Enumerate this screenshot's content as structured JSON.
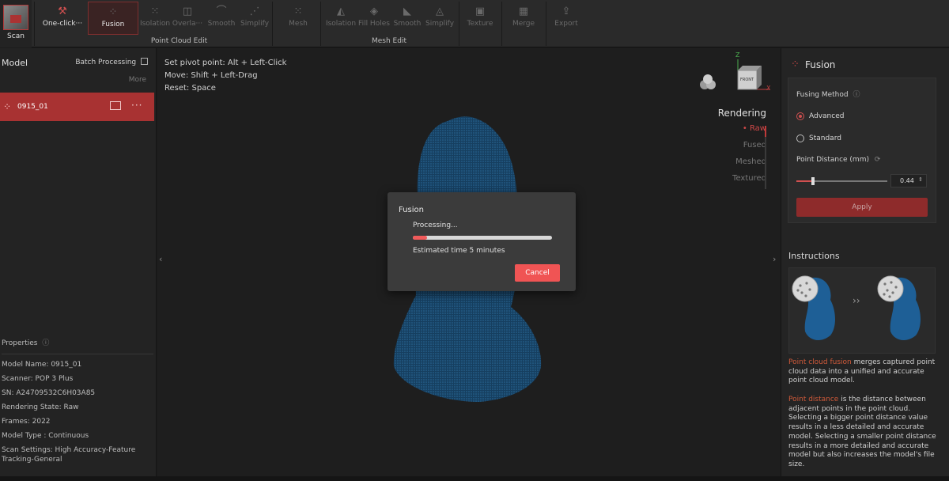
{
  "toolbar": {
    "scan_label": "Scan",
    "one_click_label": "One-click···",
    "fusion_label": "Fusion",
    "isolation_label": "Isolation",
    "overlap_label": "Overla···",
    "smooth_label": "Smooth",
    "simplify_label": "Simplify",
    "point_cloud_edit_label": "Point Cloud Edit",
    "mesh_label": "Mesh",
    "mesh_isolation_label": "Isolation",
    "fill_holes_label": "Fill Holes",
    "mesh_smooth_label": "Smooth",
    "mesh_simplify_label": "Simplify",
    "mesh_edit_label": "Mesh Edit",
    "texture_label": "Texture",
    "merge_label": "Merge",
    "export_label": "Export"
  },
  "left": {
    "title": "Model",
    "batch_label": "Batch Processing",
    "more_label": "More",
    "model_name": "0915_01",
    "menu_label": "···",
    "properties_title": "Properties",
    "properties": [
      "Model Name:  0915_01",
      "Scanner:  POP 3 Plus",
      "SN:  A24709532C6H03A85",
      "Rendering State:  Raw",
      "Frames:  2022",
      "Model Type :  Continuous",
      "Scan Settings:  High Accuracy-Feature Tracking-General"
    ]
  },
  "viewport": {
    "hint1": "Set pivot point: Alt + Left-Click",
    "hint2": "Move: Shift + Left-Drag",
    "hint3": "Reset: Space",
    "rendering_title": "Rendering",
    "render_options": [
      "Raw",
      "Fused",
      "Meshed",
      "Textured"
    ],
    "render_selected_marker": "•",
    "axis_z": "Z",
    "axis_x": "X",
    "axis_face_label": "FRONT",
    "left_arrow": "‹",
    "right_arrow": "›"
  },
  "modal": {
    "title": "Fusion",
    "status": "Processing...",
    "progress": 0.1,
    "estimate": "Estimated time 5 minutes",
    "cancel_label": "Cancel"
  },
  "right": {
    "title": "Fusion",
    "fusing_method_label": "Fusing Method",
    "info_icon": "ⓘ",
    "options": [
      "Advanced",
      "Standard"
    ],
    "selected_option": "Advanced",
    "point_distance_label": "Point Distance (mm)",
    "refresh_icon": "⟳",
    "point_distance_value": "0.44",
    "slider_fraction": 0.18,
    "apply_label": "Apply",
    "instructions_title": "Instructions",
    "compare_arrows": "››",
    "para1_hl": "Point cloud fusion",
    "para1_rest": " merges captured point cloud data into a unified and accurate point cloud model.",
    "para2_hl": "Point distance",
    "para2_rest": " is the distance between adjacent points in the point cloud. Selecting a bigger point distance value results in a less detailed and accurate model. Selecting a smaller point distance results in a more detailed and accurate model but also increases the model's file size."
  },
  "colors": {
    "accent": "#f05454",
    "active_row": "#a83232",
    "model_blue": "#1a4f78"
  }
}
